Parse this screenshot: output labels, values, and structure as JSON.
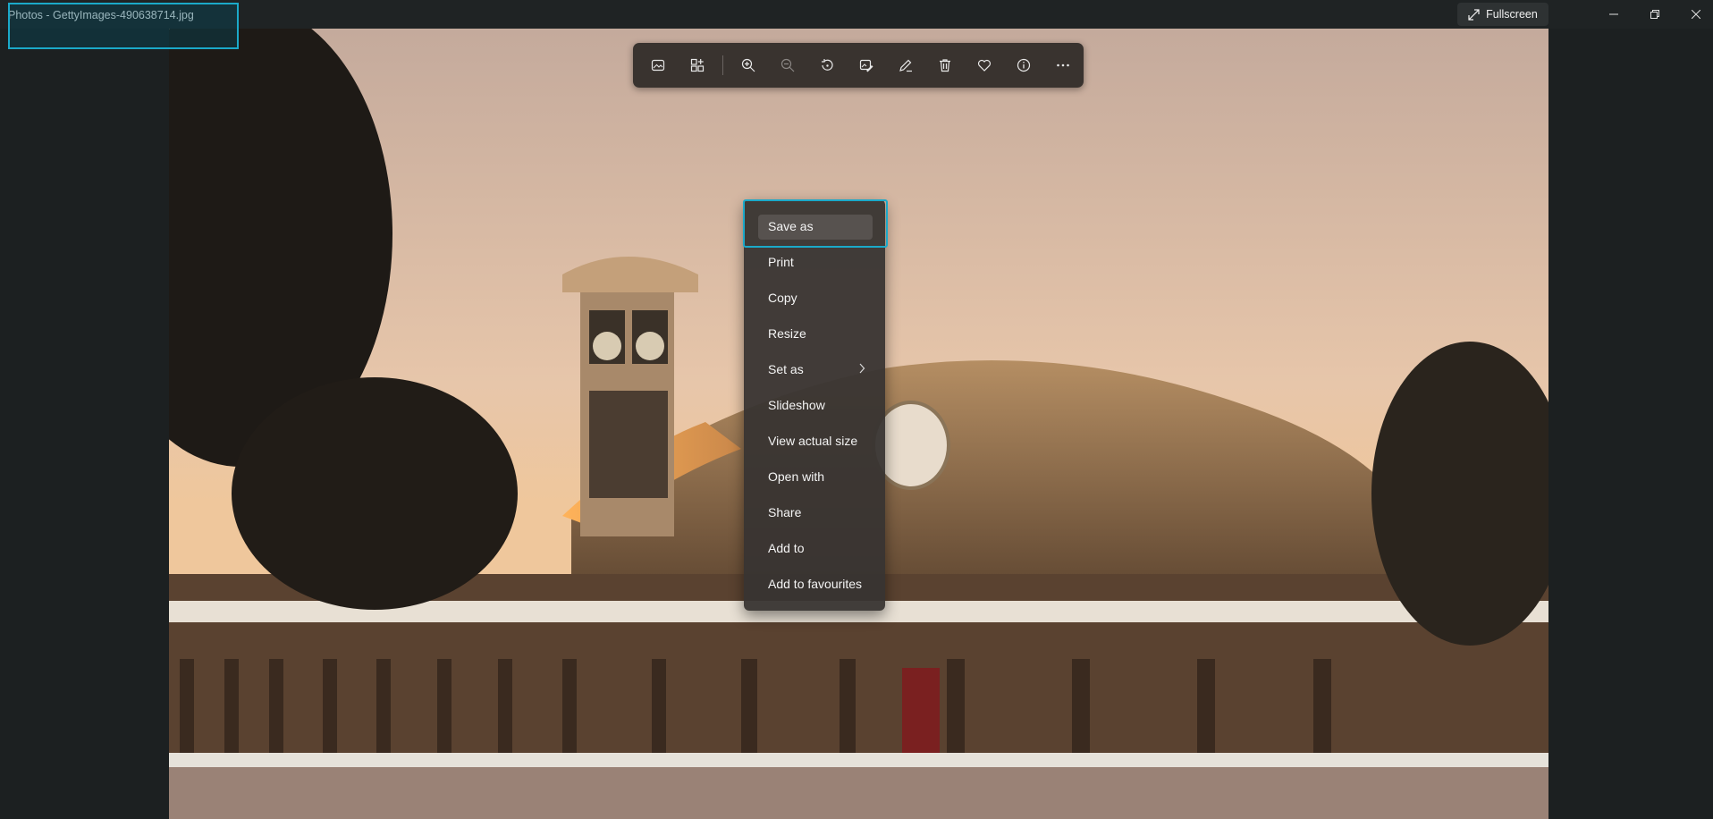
{
  "window": {
    "title": "Photos - GettyImages-490638714.jpg",
    "fullscreen_label": "Fullscreen"
  },
  "toolbar": {
    "buttons": [
      "photo-icon",
      "gallery-icon",
      "zoom-in-icon",
      "zoom-out-icon",
      "rotate-icon",
      "edit-image-icon",
      "draw-icon",
      "delete-icon",
      "favourite-icon",
      "info-icon",
      "more-icon"
    ]
  },
  "context_menu": {
    "items": [
      {
        "label": "Save as"
      },
      {
        "label": "Print"
      },
      {
        "label": "Copy"
      },
      {
        "label": "Resize"
      },
      {
        "label": "Set as"
      },
      {
        "label": "Slideshow"
      },
      {
        "label": "View actual size"
      },
      {
        "label": "Open with"
      },
      {
        "label": "Share"
      },
      {
        "label": "Add to"
      },
      {
        "label": "Add to favourites"
      }
    ]
  },
  "colors": {
    "focus_outline": "#1ba9c9",
    "titlebar_bg": "#1f2324",
    "menu_bg": "#383432"
  }
}
